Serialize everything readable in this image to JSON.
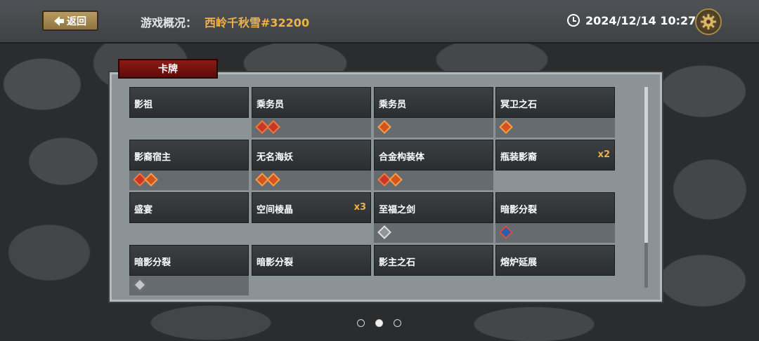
{
  "header": {
    "back_label": "返回",
    "overview_label": "游戏概况：",
    "server_name": "西岭千秋雪#32200",
    "datetime": "2024/12/14 10:27"
  },
  "panel": {
    "tab_label": "卡牌"
  },
  "cards": [
    {
      "name": "影祖",
      "count": "",
      "gems": []
    },
    {
      "name": "乘务员",
      "count": "",
      "gems": [
        "red",
        "red"
      ]
    },
    {
      "name": "乘务员",
      "count": "",
      "gems": [
        "orange"
      ]
    },
    {
      "name": "冥卫之石",
      "count": "",
      "gems": [
        "orange"
      ]
    },
    {
      "name": "影裔宿主",
      "count": "",
      "gems": [
        "red",
        "orange"
      ]
    },
    {
      "name": "无名海妖",
      "count": "",
      "gems": [
        "orange",
        "orange"
      ]
    },
    {
      "name": "合金构装体",
      "count": "",
      "gems": [
        "red",
        "orange"
      ]
    },
    {
      "name": "瓶装影裔",
      "count": "x2",
      "gems": []
    },
    {
      "name": "盛宴",
      "count": "",
      "gems": []
    },
    {
      "name": "空间棱晶",
      "count": "x3",
      "gems": []
    },
    {
      "name": "至福之剑",
      "count": "",
      "gems": [
        "silver"
      ]
    },
    {
      "name": "暗影分裂",
      "count": "",
      "gems": [
        "blue"
      ]
    },
    {
      "name": "暗影分裂",
      "count": "",
      "gems": [
        "gray"
      ]
    },
    {
      "name": "暗影分裂",
      "count": "",
      "gems": []
    },
    {
      "name": "影主之石",
      "count": "",
      "gems": []
    },
    {
      "name": "熔炉延展",
      "count": "",
      "gems": []
    }
  ],
  "pagination": {
    "pages": 3,
    "current": 2
  },
  "colors": {
    "accent": "#f0b14a",
    "tab_red": "#8a1a14"
  }
}
